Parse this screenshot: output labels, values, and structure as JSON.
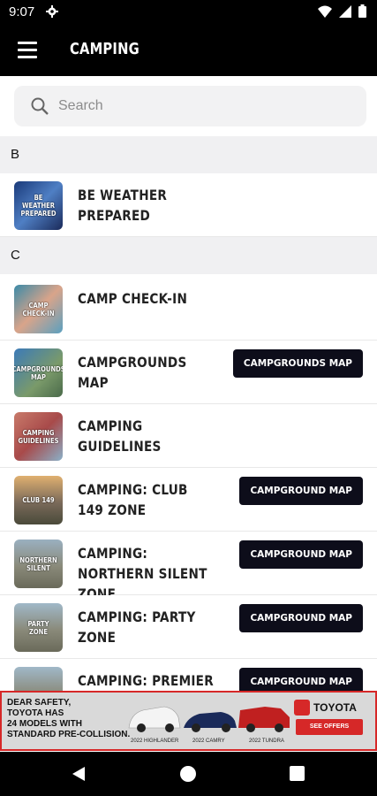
{
  "status": {
    "time": "9:07"
  },
  "appbar": {
    "title": "CAMPING"
  },
  "search": {
    "placeholder": "Search"
  },
  "sections": [
    {
      "letter": "B"
    },
    {
      "letter": "C"
    }
  ],
  "items": [
    {
      "name": "BE WEATHER PREPARED",
      "thumb_text": "BE WEATHER PREPARED",
      "button": ""
    },
    {
      "name": "CAMP CHECK-IN",
      "thumb_text": "CAMP CHECK-IN",
      "button": ""
    },
    {
      "name": "CAMPGROUNDS MAP",
      "thumb_text": "CAMPGROUNDS MAP",
      "button": "CAMPGROUNDS MAP"
    },
    {
      "name": "CAMPING GUIDELINES",
      "thumb_text": "CAMPING GUIDELINES",
      "button": ""
    },
    {
      "name": "CAMPING: CLUB 149 ZONE",
      "thumb_text": "CLUB 149",
      "button": "CAMPGROUND MAP"
    },
    {
      "name": "CAMPING: NORTHERN SILENT ZONE",
      "thumb_text": "NORTHERN SILENT",
      "button": "CAMPGROUND MAP"
    },
    {
      "name": "CAMPING: PARTY ZONE",
      "thumb_text": "PARTY ZONE",
      "button": "CAMPGROUND MAP"
    },
    {
      "name": "CAMPING: PREMIER PARTY",
      "thumb_text": "",
      "button": "CAMPGROUND MAP"
    }
  ],
  "ad": {
    "text_line1": "DEAR SAFETY,",
    "text_line2": "TOYOTA HAS",
    "text_line3": "24 MODELS WITH",
    "text_line4": "STANDARD PRE-COLLISION.",
    "car1": "2022 HIGHLANDER",
    "car2": "2022 CAMRY",
    "car3": "2022 TUNDRA",
    "brand": "TOYOTA",
    "cta": "SEE OFFERS"
  },
  "colors": {
    "accent": "#0d0d1a",
    "ad_red": "#d62828"
  }
}
